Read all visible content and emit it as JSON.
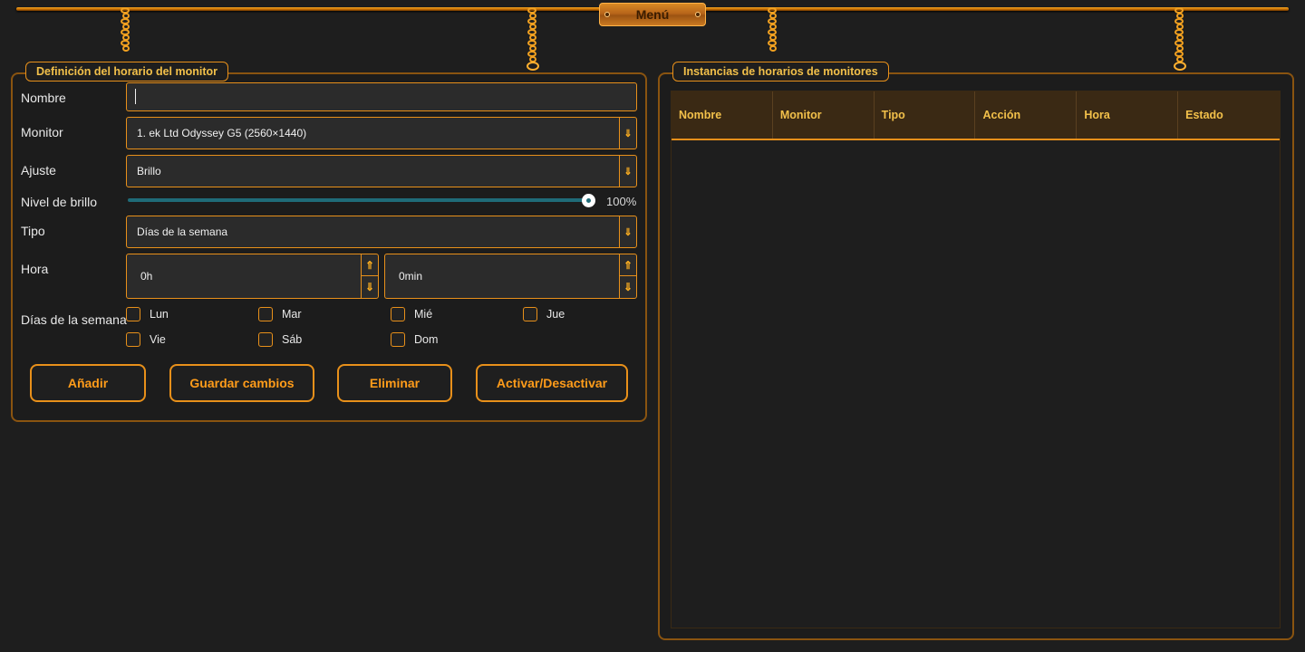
{
  "menu": {
    "label": "Menú"
  },
  "definition": {
    "title": "Definición del horario del monitor",
    "name_label": "Nombre",
    "name_value": "",
    "monitor_label": "Monitor",
    "monitor_value": "1. ek Ltd Odyssey G5 (2560×1440)",
    "setting_label": "Ajuste",
    "setting_value": "Brillo",
    "brightness_label": "Nivel de brillo",
    "brightness_value": "100%",
    "brightness_level": 1.0,
    "type_label": "Tipo",
    "type_value": "Días de la semana",
    "time_label": "Hora",
    "hours_value": "0h",
    "minutes_value": "0min",
    "weekdays_label": "Días de la semana",
    "days": [
      {
        "label": "Lun",
        "checked": false
      },
      {
        "label": "Mar",
        "checked": false
      },
      {
        "label": "Mié",
        "checked": false
      },
      {
        "label": "Jue",
        "checked": false
      },
      {
        "label": "Vie",
        "checked": false
      },
      {
        "label": "Sáb",
        "checked": false
      },
      {
        "label": "Dom",
        "checked": false
      }
    ],
    "buttons": {
      "add": "Añadir",
      "save": "Guardar cambios",
      "delete": "Eliminar",
      "toggle": "Activar/Desactivar"
    }
  },
  "instances": {
    "title": "Instancias de horarios de monitores",
    "columns": [
      "Nombre",
      "Monitor",
      "Tipo",
      "Acción",
      "Hora",
      "Estado"
    ],
    "rows": []
  },
  "icons": {
    "combo_arrow": "chevron-down-icon",
    "spin_up": "arrow-up-icon",
    "spin_down": "arrow-down-icon"
  },
  "colors": {
    "accent": "#e8901a",
    "title_text": "#f2c04a",
    "slider": "#1f6b78",
    "background": "#1e1e1e"
  }
}
